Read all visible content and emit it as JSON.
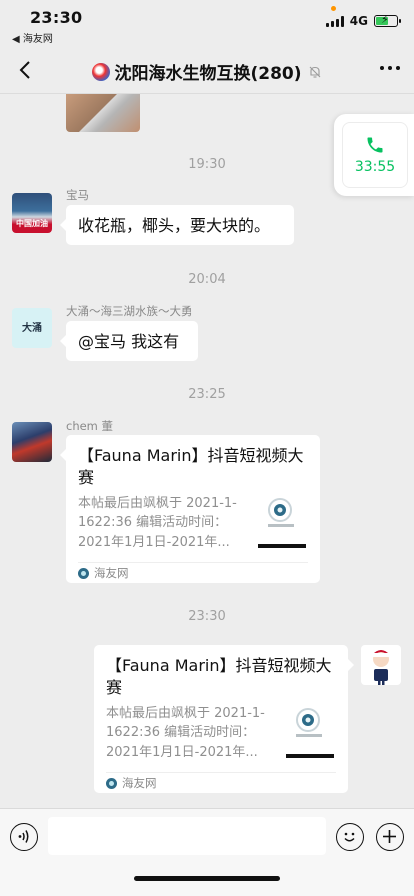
{
  "status_bar": {
    "time": "23:30",
    "back_app": "◀ 海友网",
    "network": "4G"
  },
  "nav": {
    "title": "沈阳海水生物互换(280)",
    "back_icon": "chevron-left-icon",
    "more_icon": "more-horizontal-icon",
    "mute_icon": "bell-off-icon"
  },
  "call": {
    "duration": "33:55",
    "icon": "phone-icon",
    "color": "#07c160"
  },
  "messages": {
    "ts1": "19:30",
    "m1_sender": "宝马",
    "m1_text": "收花瓶，椰头，要大块的。",
    "m1_avatar_label": "中国加油",
    "ts2": "20:04",
    "m2_sender": "大涌～海三湖水族～大勇",
    "m2_text": "@宝马 我这有",
    "m2_avatar_label": "大涌",
    "ts3": "23:25",
    "m3_sender": "chem 董",
    "m3_card_title": "【Fauna Marin】抖音短视频大赛",
    "m3_card_desc": "本帖最后由飒枫于 2021-1-1622:36 编辑活动时间：2021年1月1日-2021年...",
    "m3_card_source": "海友网",
    "ts4": "23:30",
    "m4_card_title": "【Fauna Marin】抖音短视频大赛",
    "m4_card_desc": "本帖最后由飒枫于 2021-1-1622:36 编辑活动时间：2021年1月1日-2021年...",
    "m4_card_source": "海友网"
  },
  "input": {
    "placeholder": "",
    "voice_icon": "voice-icon",
    "emoji_icon": "emoji-icon",
    "plus_icon": "plus-icon"
  },
  "colors": {
    "background": "#ededed",
    "bubble": "#ffffff",
    "accent": "#07c160",
    "timestamp": "#a0a0a0"
  }
}
